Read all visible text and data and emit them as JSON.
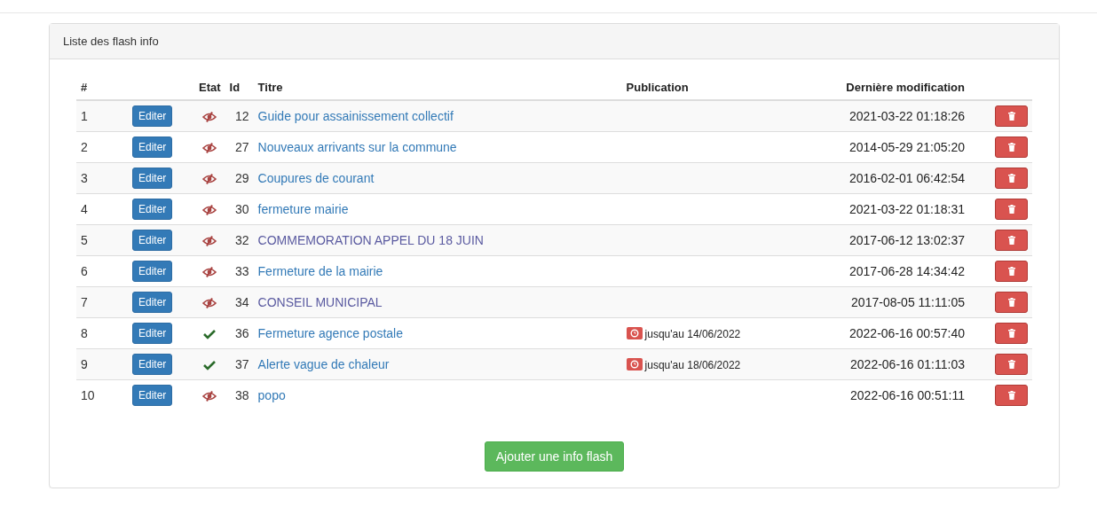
{
  "panel": {
    "title": "Liste des flash info"
  },
  "table": {
    "columns": [
      "#",
      "Etat",
      "Id",
      "Titre",
      "Publication",
      "Dernière modification"
    ],
    "rows": [
      {
        "num": "1",
        "edit": "Editer",
        "published": false,
        "id": "12",
        "title": "Guide pour assainissement collectif",
        "visited": false,
        "modified": "2021-03-22 01:18:26"
      },
      {
        "num": "2",
        "edit": "Editer",
        "published": false,
        "id": "27",
        "title": "Nouveaux arrivants sur la commune",
        "visited": false,
        "modified": "2014-05-29 21:05:20"
      },
      {
        "num": "3",
        "edit": "Editer",
        "published": false,
        "id": "29",
        "title": "Coupures de courant",
        "visited": false,
        "modified": "2016-02-01 06:42:54"
      },
      {
        "num": "4",
        "edit": "Editer",
        "published": false,
        "id": "30",
        "title": "fermeture mairie",
        "visited": false,
        "modified": "2021-03-22 01:18:31"
      },
      {
        "num": "5",
        "edit": "Editer",
        "published": false,
        "id": "32",
        "title": "COMMEMORATION APPEL DU 18 JUIN",
        "visited": true,
        "modified": "2017-06-12 13:02:37"
      },
      {
        "num": "6",
        "edit": "Editer",
        "published": false,
        "id": "33",
        "title": "Fermeture de la mairie",
        "visited": false,
        "modified": "2017-06-28 14:34:42"
      },
      {
        "num": "7",
        "edit": "Editer",
        "published": false,
        "id": "34",
        "title": "CONSEIL MUNICIPAL",
        "visited": true,
        "modified": "2017-08-05 11:11:05"
      },
      {
        "num": "8",
        "edit": "Editer",
        "published": true,
        "id": "36",
        "title": "Fermeture agence postale",
        "visited": false,
        "publication": "jusqu'au 14/06/2022",
        "modified": "2022-06-16 00:57:40"
      },
      {
        "num": "9",
        "edit": "Editer",
        "published": true,
        "id": "37",
        "title": "Alerte vague de chaleur",
        "visited": false,
        "publication": "jusqu'au 18/06/2022",
        "modified": "2022-06-16 01:11:03"
      },
      {
        "num": "10",
        "edit": "Editer",
        "published": false,
        "id": "38",
        "title": "popo",
        "visited": false,
        "modified": "2022-06-16 00:51:11"
      }
    ]
  },
  "add_button": "Ajouter une info flash"
}
